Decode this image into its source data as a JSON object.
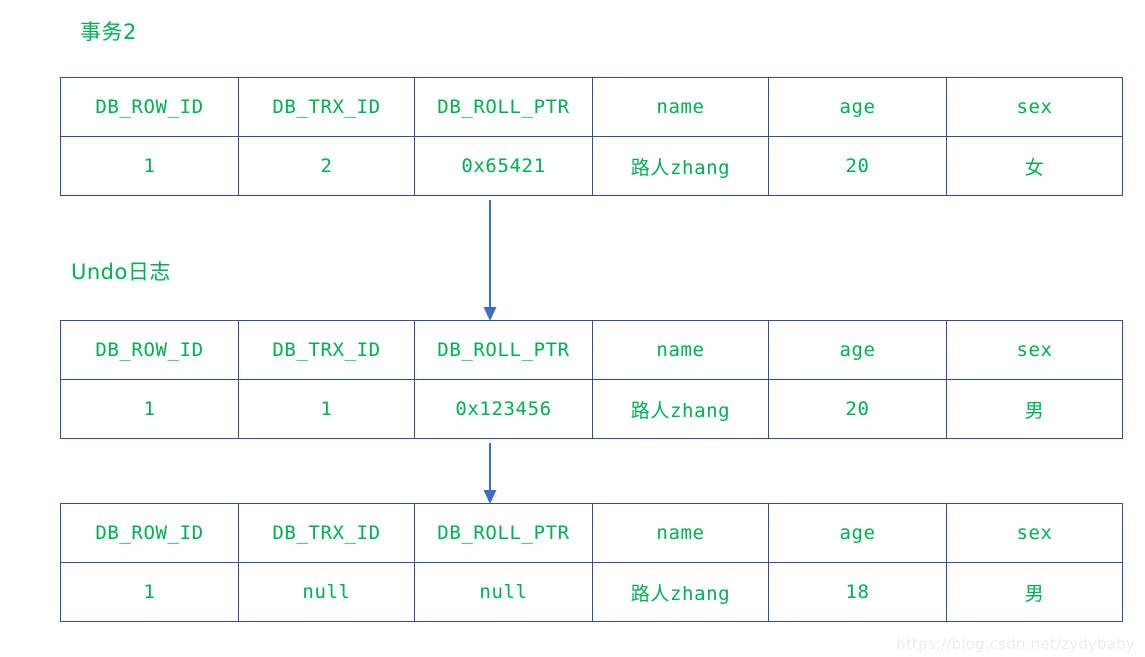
{
  "diagram": {
    "title_label": "事务2",
    "undo_log_label": "Undo日志",
    "watermark": "https://blog.csdn.net/zydybaby",
    "colors": {
      "text_green": "#00b050",
      "border_blue": "#2e5390",
      "arrow_blue": "#3a6fc4",
      "watermark_gray": "#eceded",
      "background": "#ffffff"
    },
    "columns": [
      "DB_ROW_ID",
      "DB_TRX_ID",
      "DB_ROLL_PTR",
      "name",
      "age",
      "sex"
    ],
    "tables": [
      {
        "id": "current-record",
        "headers": [
          "DB_ROW_ID",
          "DB_TRX_ID",
          "DB_ROLL_PTR",
          "name",
          "age",
          "sex"
        ],
        "row": [
          "1",
          "2",
          "0x65421",
          "路人zhang",
          "20",
          "女"
        ]
      },
      {
        "id": "undo-version-1",
        "headers": [
          "DB_ROW_ID",
          "DB_TRX_ID",
          "DB_ROLL_PTR",
          "name",
          "age",
          "sex"
        ],
        "row": [
          "1",
          "1",
          "0x123456",
          "路人zhang",
          "20",
          "男"
        ]
      },
      {
        "id": "undo-version-2",
        "headers": [
          "DB_ROW_ID",
          "DB_TRX_ID",
          "DB_ROLL_PTR",
          "name",
          "age",
          "sex"
        ],
        "row": [
          "1",
          "null",
          "null",
          "路人zhang",
          "18",
          "男"
        ]
      }
    ],
    "arrows": [
      {
        "id": "current-to-undo1",
        "from": "current-record",
        "to": "undo-version-1",
        "direction": "down"
      },
      {
        "id": "undo1-to-undo2",
        "from": "undo-version-1",
        "to": "undo-version-2",
        "direction": "down"
      }
    ]
  }
}
